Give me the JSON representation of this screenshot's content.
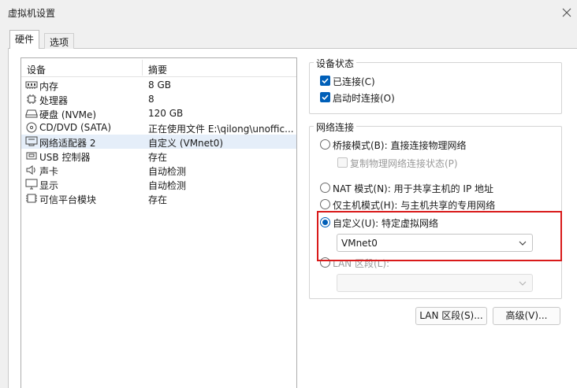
{
  "window": {
    "title": "虚拟机设置"
  },
  "tabs": [
    {
      "label": "硬件"
    },
    {
      "label": "选项"
    }
  ],
  "device_list": {
    "headers": {
      "device": "设备",
      "summary": "摘要"
    },
    "rows": [
      {
        "icon": "memory-icon",
        "name": "内存",
        "summary": "8 GB"
      },
      {
        "icon": "processor-icon",
        "name": "处理器",
        "summary": "8"
      },
      {
        "icon": "disk-icon",
        "name": "硬盘 (NVMe)",
        "summary": "120 GB"
      },
      {
        "icon": "cd-dvd-icon",
        "name": "CD/DVD (SATA)",
        "summary": "正在使用文件 E:\\qilong\\unoffic..."
      },
      {
        "icon": "network-icon",
        "name": "网络适配器 2",
        "summary": "自定义 (VMnet0)"
      },
      {
        "icon": "usb-icon",
        "name": "USB 控制器",
        "summary": "存在"
      },
      {
        "icon": "sound-icon",
        "name": "声卡",
        "summary": "自动检测"
      },
      {
        "icon": "display-icon",
        "name": "显示",
        "summary": "自动检测"
      },
      {
        "icon": "tpm-icon",
        "name": "可信平台模块",
        "summary": "存在"
      }
    ]
  },
  "device_status": {
    "title": "设备状态",
    "connected": "已连接(C)",
    "connect_at_power_on": "启动时连接(O)"
  },
  "network_connection": {
    "title": "网络连接",
    "bridged": "桥接模式(B): 直接连接物理网络",
    "replicate": "复制物理网络连接状态(P)",
    "nat": "NAT 模式(N): 用于共享主机的 IP 地址",
    "host_only": "仅主机模式(H): 与主机共享的专用网络",
    "custom": "自定义(U): 特定虚拟网络",
    "custom_value": "VMnet0",
    "lan_segment": "LAN 区段(L):",
    "lan_segment_value": ""
  },
  "buttons": {
    "lan_segments": "LAN 区段(S)...",
    "advanced": "高级(V)..."
  },
  "colors": {
    "accent": "#005fb8",
    "highlight_box": "#d91a1a",
    "selected_row": "#e5eef9"
  }
}
